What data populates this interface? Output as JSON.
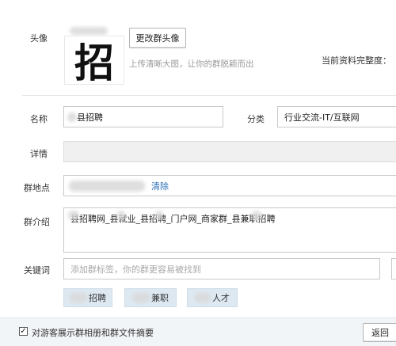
{
  "avatar": {
    "label": "头像",
    "char": "招",
    "change_button": "更改群头像",
    "hint": "上传清晰大图，让你的群脱颖而出",
    "completeness_label": "当前资料完整度："
  },
  "name": {
    "label": "名称",
    "value": "县招聘"
  },
  "category": {
    "label": "分类",
    "value": "行业交流-IT/互联网"
  },
  "details": {
    "label": "详情",
    "value": ""
  },
  "location": {
    "label": "群地点",
    "clear_link": "清除"
  },
  "intro": {
    "label": "群介绍",
    "value": "县招聘网_县就业_县招聘_门户网_商家群_县兼职招聘"
  },
  "keywords": {
    "label": "关键词",
    "placeholder": "添加群标签，你的群更容易被找到",
    "tags": [
      "招聘",
      "兼职",
      "人才"
    ]
  },
  "footer": {
    "show_album_label": "对游客展示群相册和群文件摘要",
    "show_album_checked": true,
    "back_button": "返回"
  }
}
